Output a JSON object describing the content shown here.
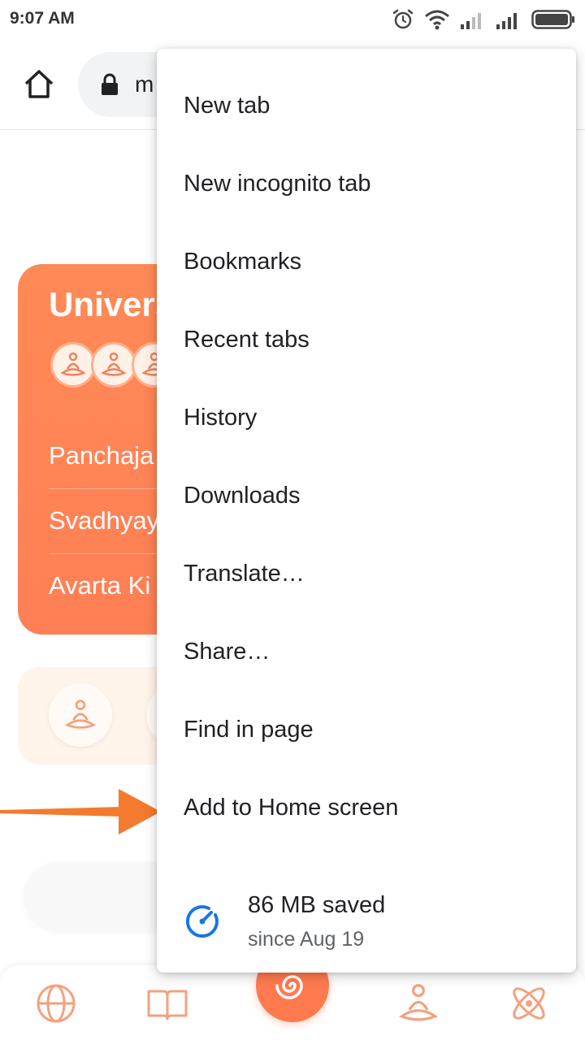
{
  "status_bar": {
    "time": "9:07 AM",
    "icons": [
      "alarm-icon",
      "wifi-icon",
      "signal-icon",
      "signal-icon",
      "battery-icon"
    ]
  },
  "toolbar": {
    "home_icon": "home-icon",
    "lock_icon": "lock-icon",
    "url_visible": "m"
  },
  "page": {
    "hero_title": "Univers",
    "hero_items": [
      "Panchaja",
      "Svadhyay",
      "Avarta Ki"
    ],
    "accent_color": "#ff7f55"
  },
  "menu": {
    "items": [
      {
        "label": "New tab"
      },
      {
        "label": "New incognito tab"
      },
      {
        "label": "Bookmarks"
      },
      {
        "label": "Recent tabs"
      },
      {
        "label": "History"
      },
      {
        "label": "Downloads"
      },
      {
        "label": "Translate…"
      },
      {
        "label": "Share…"
      },
      {
        "label": "Find in page"
      },
      {
        "label": "Add to Home screen"
      }
    ],
    "savings": {
      "title": "86 MB saved",
      "subtitle": "since Aug 19",
      "icon": "speedometer-icon",
      "icon_color": "#1a73e8"
    }
  },
  "bottom_nav": {
    "icons": [
      "globe-icon",
      "book-icon",
      "spiral-icon",
      "meditation-icon",
      "atom-icon"
    ]
  }
}
